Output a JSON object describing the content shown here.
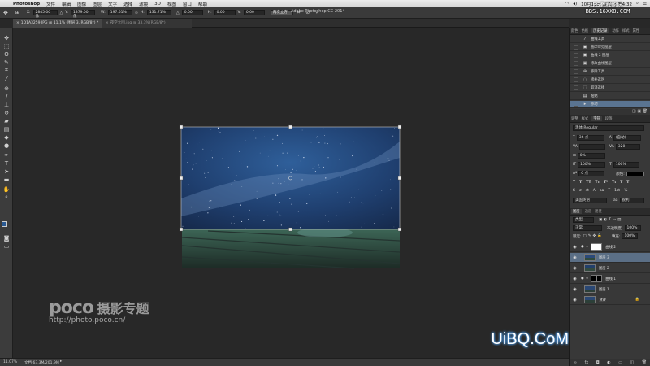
{
  "menubar": {
    "apple": "",
    "app": "Photoshop",
    "items": [
      "文件",
      "编辑",
      "图像",
      "图层",
      "文字",
      "选择",
      "滤镜",
      "3D",
      "视图",
      "窗口",
      "帮助"
    ],
    "clock": "10月11日 周六 下午4:32",
    "watermark_top": "PS教程论坛",
    "watermark_top2": "BBS.16XX8.COM"
  },
  "window_title": "Adobe Photoshop CC 2014",
  "options": {
    "x_label": "X:",
    "x_value": "2845.00 像",
    "y_label": "Y:",
    "y_value": "1379.00 像",
    "w_label": "W:",
    "w_value": "197.61%",
    "h_label": "H:",
    "h_value": "131.71%",
    "angle_value": "0.00",
    "hskew_label": "H:",
    "hskew_value": "0.00",
    "vskew_label": "V:",
    "vskew_value": "0.00",
    "interp": "两次立方"
  },
  "tabs": [
    {
      "label": "1D1A3259.JPG @ 11.1% (图层 3, RGB/8*) *"
    },
    {
      "label": "夜空大图.jpg @ 33.3%(RGB/8*)"
    }
  ],
  "status": {
    "zoom": "11.07%",
    "doc": "文档:63.3M/201.9M"
  },
  "canvas_watermark": {
    "brand": "poco",
    "brand_cn": "摄影专题",
    "url": "http://photo.poco.cn/",
    "corner": "UiBQ.CoM"
  },
  "history": {
    "tabs": [
      "颜色",
      "色板",
      "历史记录",
      "动作",
      "样式",
      "属性"
    ],
    "active_tab": "历史记录",
    "items": [
      "曲线工具",
      "盖印可见图层",
      "曲线 2 图层",
      "修改曲线图层",
      "移除工具",
      "修补选区",
      "取消选择",
      "粘贴",
      "移动"
    ]
  },
  "character": {
    "tabs": [
      "调整",
      "样式",
      "字符",
      "段落"
    ],
    "font_family": "黑体 Regular",
    "font_size": "36 点",
    "leading": "(自动)",
    "tracking": "320",
    "scale_pct": "0%",
    "vscale": "100%",
    "hscale": "100%",
    "baseline": "0 点",
    "color_label": "颜色:",
    "language": "美国英语",
    "aa": "锐利"
  },
  "layers": {
    "tabs": [
      "图层",
      "通道",
      "路径"
    ],
    "kind": "类型",
    "blend": "正常",
    "opacity_label": "不透明度:",
    "opacity": "100%",
    "fill_label": "填充:",
    "fill": "100%",
    "lock_label": "锁定:",
    "items": [
      {
        "name": "曲线 2",
        "type": "adj"
      },
      {
        "name": "图层 3",
        "type": "img"
      },
      {
        "name": "图层 2",
        "type": "img"
      },
      {
        "name": "曲线 1",
        "type": "adj"
      },
      {
        "name": "图层 1",
        "type": "img"
      },
      {
        "name": "背景",
        "type": "img"
      }
    ]
  }
}
